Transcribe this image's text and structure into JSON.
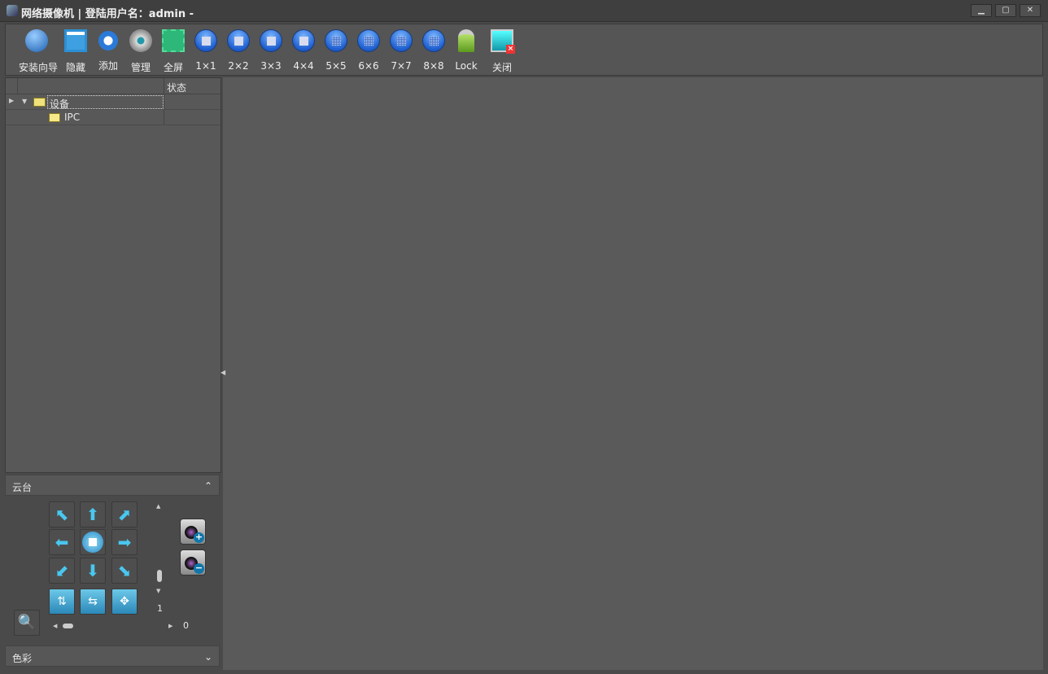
{
  "window": {
    "title": "网络摄像机 | 登陆用户名：admin -",
    "controls": [
      "minimize",
      "maximize",
      "close"
    ]
  },
  "toolbar": [
    {
      "label": "安装向导",
      "icon": "wizard-icon"
    },
    {
      "label": "隐藏",
      "icon": "hide-panel-icon"
    },
    {
      "label": "添加",
      "icon": "search-add-icon"
    },
    {
      "label": "管理",
      "icon": "gear-icon"
    },
    {
      "label": "全屏",
      "icon": "fullscreen-icon"
    },
    {
      "label": "1×1",
      "icon": "layout-1x1-icon"
    },
    {
      "label": "2×2",
      "icon": "layout-2x2-icon"
    },
    {
      "label": "3×3",
      "icon": "layout-3x3-icon"
    },
    {
      "label": "4×4",
      "icon": "layout-4x4-icon"
    },
    {
      "label": "5×5",
      "icon": "layout-5x5-icon"
    },
    {
      "label": "6×6",
      "icon": "layout-6x6-icon"
    },
    {
      "label": "7×7",
      "icon": "layout-7x7-icon"
    },
    {
      "label": "8×8",
      "icon": "layout-8x8-icon"
    },
    {
      "label": "Lock",
      "icon": "lock-icon"
    },
    {
      "label": "关闭",
      "icon": "close-monitor-icon"
    }
  ],
  "tree": {
    "status_header": "状态",
    "root": "设备",
    "child": "IPC"
  },
  "ptz": {
    "title": "云台",
    "speed_value": "1",
    "zoom_value": "0"
  },
  "color": {
    "title": "色彩"
  }
}
